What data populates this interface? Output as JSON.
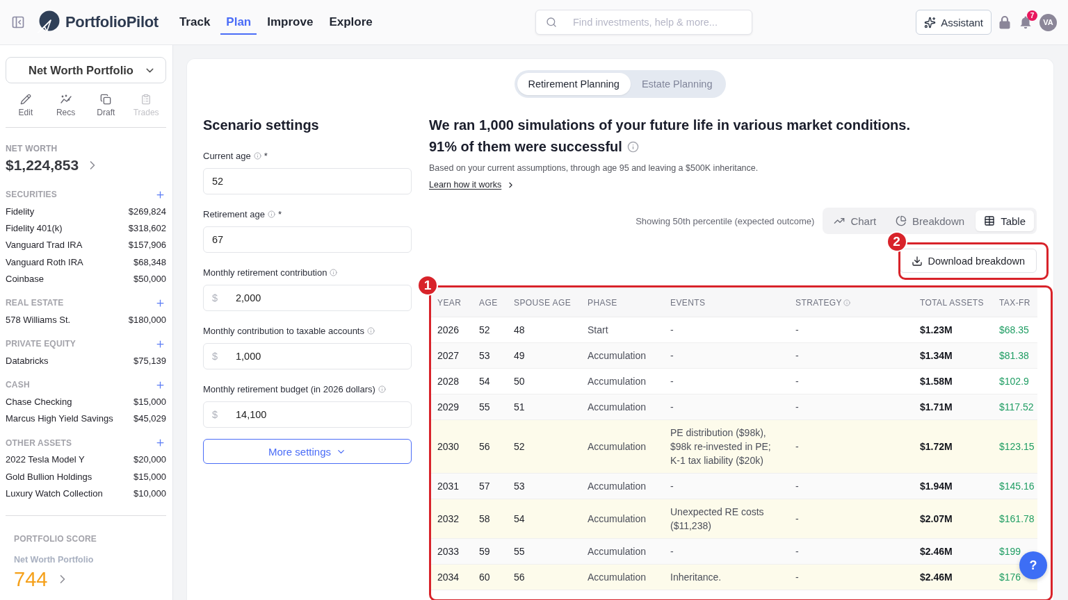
{
  "header": {
    "brand": "PortfolioPilot",
    "nav": [
      {
        "label": "Track",
        "selected": false
      },
      {
        "label": "Plan",
        "selected": true
      },
      {
        "label": "Improve",
        "selected": false
      },
      {
        "label": "Explore",
        "selected": false
      }
    ],
    "search": {
      "placeholder": "Find investments, help & more..."
    },
    "assistant_button": "Assistant",
    "notification_badge": "7",
    "avatar": "VA"
  },
  "sidebar": {
    "portfolio_select": "Net Worth Portfolio",
    "actions": [
      {
        "label": "Edit",
        "kind": "edit",
        "disabled": false
      },
      {
        "label": "Recs",
        "kind": "recs",
        "disabled": false
      },
      {
        "label": "Draft",
        "kind": "draft",
        "disabled": false
      },
      {
        "label": "Trades",
        "kind": "trades",
        "disabled": true
      }
    ],
    "net_worth": {
      "label": "NET WORTH",
      "value": "$1,224,853"
    },
    "sections": [
      {
        "title": "SECURITIES",
        "items": [
          {
            "name": "Fidelity",
            "value": "$269,824"
          },
          {
            "name": "Fidelity 401(k)",
            "value": "$318,602"
          },
          {
            "name": "Vanguard Trad IRA",
            "value": "$157,906"
          },
          {
            "name": "Vanguard Roth IRA",
            "value": "$68,348"
          },
          {
            "name": "Coinbase",
            "value": "$50,000"
          }
        ]
      },
      {
        "title": "REAL ESTATE",
        "items": [
          {
            "name": "578 Williams St.",
            "value": "$180,000"
          }
        ]
      },
      {
        "title": "PRIVATE EQUITY",
        "items": [
          {
            "name": "Databricks",
            "value": "$75,139"
          }
        ]
      },
      {
        "title": "CASH",
        "items": [
          {
            "name": "Chase Checking",
            "value": "$15,000"
          },
          {
            "name": "Marcus High Yield Savings",
            "value": "$45,029"
          }
        ]
      },
      {
        "title": "OTHER ASSETS",
        "items": [
          {
            "name": "2022 Tesla Model Y",
            "value": "$20,000"
          },
          {
            "name": "Gold Bullion Holdings",
            "value": "$15,000"
          },
          {
            "name": "Luxury Watch Collection",
            "value": "$10,000"
          }
        ]
      }
    ],
    "portfolio_score": {
      "label": "PORTFOLIO SCORE",
      "portfolio": "Net Worth Portfolio",
      "score": "744"
    }
  },
  "plan_tabs": [
    {
      "label": "Retirement Planning",
      "selected": true
    },
    {
      "label": "Estate Planning",
      "selected": false
    }
  ],
  "scenario_settings": {
    "title": "Scenario settings",
    "fields": [
      {
        "label": "Current age",
        "info": true,
        "required_mark": "*",
        "value": "52"
      },
      {
        "label": "Retirement age",
        "info": true,
        "required_mark": "*",
        "value": "67"
      },
      {
        "label": "Monthly retirement contribution",
        "info": true,
        "prefix": "$",
        "value": "2,000"
      },
      {
        "label": "Monthly contribution to taxable accounts",
        "info": true,
        "prefix": "$",
        "value": "1,000"
      },
      {
        "label": "Monthly retirement budget (in 2026 dollars)",
        "info": true,
        "prefix": "$",
        "value": "14,100"
      }
    ],
    "more_button": "More settings"
  },
  "results": {
    "headline": "We ran 1,000 simulations of your future life in various market conditions.",
    "success": "91% of them were successful",
    "note": "Based on your current assumptions, through age 95 and leaving a $500K inheritance.",
    "learn_link": "Learn how it works",
    "percentile_note": "Showing 50th percentile (expected outcome)",
    "views": [
      {
        "label": "Chart",
        "kind": "chart",
        "selected": false
      },
      {
        "label": "Breakdown",
        "kind": "breakdown",
        "selected": false
      },
      {
        "label": "Table",
        "kind": "table",
        "selected": true
      }
    ],
    "download_button": {
      "label": "Download breakdown",
      "annotation": "2"
    }
  },
  "table": {
    "annotation": "1",
    "columns": [
      {
        "label": "YEAR",
        "kind": "plain"
      },
      {
        "label": "AGE",
        "kind": "plain"
      },
      {
        "label": "SPOUSE AGE",
        "kind": "plain"
      },
      {
        "label": "PHASE",
        "kind": "muted"
      },
      {
        "label": "EVENTS",
        "kind": "muted"
      },
      {
        "label": "STRATEGY",
        "kind": "muted",
        "info": true
      },
      {
        "label": "TOTAL ASSETS",
        "kind": "total"
      },
      {
        "label": "TAX-FR",
        "kind": "gain"
      }
    ],
    "rows": [
      {
        "highlighted": false,
        "cells": [
          "2026",
          "52",
          "48",
          "Start",
          "-",
          "-",
          "$1.23M",
          "$68.35"
        ]
      },
      {
        "highlighted": false,
        "cells": [
          "2027",
          "53",
          "49",
          "Accumulation",
          "-",
          "-",
          "$1.34M",
          "$81.38"
        ]
      },
      {
        "highlighted": false,
        "cells": [
          "2028",
          "54",
          "50",
          "Accumulation",
          "-",
          "-",
          "$1.58M",
          "$102.9"
        ]
      },
      {
        "highlighted": false,
        "cells": [
          "2029",
          "55",
          "51",
          "Accumulation",
          "-",
          "-",
          "$1.71M",
          "$117.52"
        ]
      },
      {
        "highlighted": true,
        "cells": [
          "2030",
          "56",
          "52",
          "Accumulation",
          "PE distribution ($98k), $98k re-invested in PE; K-1 tax liability ($20k)",
          "-",
          "$1.72M",
          "$123.15"
        ]
      },
      {
        "highlighted": false,
        "cells": [
          "2031",
          "57",
          "53",
          "Accumulation",
          "-",
          "-",
          "$1.94M",
          "$145.16"
        ]
      },
      {
        "highlighted": true,
        "cells": [
          "2032",
          "58",
          "54",
          "Accumulation",
          "Unexpected RE costs ($11,238)",
          "-",
          "$2.07M",
          "$161.78"
        ]
      },
      {
        "highlighted": false,
        "cells": [
          "2033",
          "59",
          "55",
          "Accumulation",
          "-",
          "-",
          "$2.46M",
          "$199"
        ]
      },
      {
        "highlighted": true,
        "cells": [
          "2034",
          "60",
          "56",
          "Accumulation",
          "Inheritance.",
          "-",
          "$2.46M",
          "$176"
        ]
      }
    ]
  },
  "help_button": "?"
}
